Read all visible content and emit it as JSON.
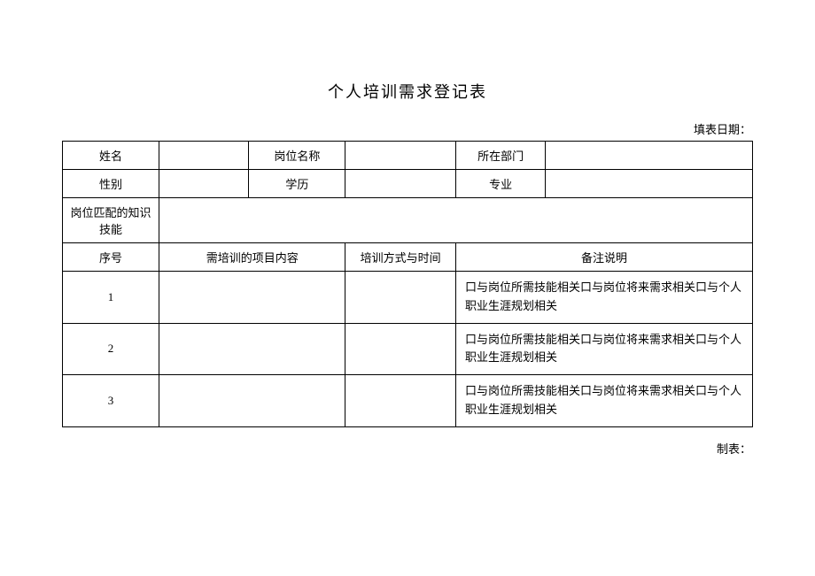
{
  "title": "个人培训需求登记表",
  "dateLabel": "填表日期：",
  "row1": {
    "label1": "姓名",
    "value1": "",
    "label2": "岗位名称",
    "value2": "",
    "label3": "所在部门",
    "value3": ""
  },
  "row2": {
    "label1": "性别",
    "value1": "",
    "label2": "学历",
    "value2": "",
    "label3": "专业",
    "value3": ""
  },
  "row3": {
    "label": "岗位匹配的知识技能",
    "value": ""
  },
  "headers": {
    "col1": "序号",
    "col2": "需培训的项目内容",
    "col3": "培训方式与时间",
    "col4": "备注说明"
  },
  "rows": [
    {
      "no": "1",
      "content": "",
      "method": "",
      "remark": "口与岗位所需技能相关口与岗位将来需求相关口与个人职业生涯规划相关"
    },
    {
      "no": "2",
      "content": "",
      "method": "",
      "remark": "口与岗位所需技能相关口与岗位将来需求相关口与个人职业生涯规划相关"
    },
    {
      "no": "3",
      "content": "",
      "method": "",
      "remark": "口与岗位所需技能相关口与岗位将来需求相关口与个人职业生涯规划相关"
    }
  ],
  "footer": "制表："
}
